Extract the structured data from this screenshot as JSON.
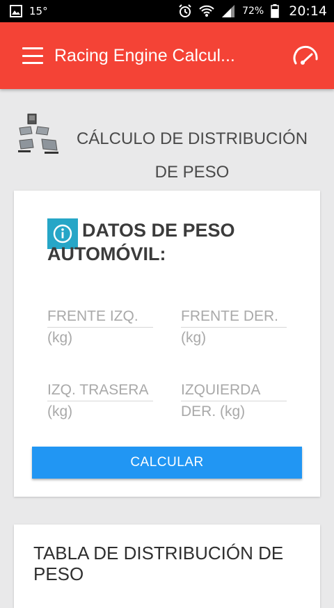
{
  "status_bar": {
    "temperature": "15°",
    "battery": "72%",
    "time": "20:14"
  },
  "app_bar": {
    "title": "Racing Engine Calcul..."
  },
  "section": {
    "title": "CÁLCULO DE DISTRIBUCIÓN DE PESO"
  },
  "input_card": {
    "heading": "DATOS DE PESO AUTOMÓVIL:",
    "fields": [
      {
        "label": "FRENTE IZQ.",
        "unit": "(kg)"
      },
      {
        "label": "FRENTE DER.",
        "unit": "(kg)"
      },
      {
        "label": "IZQ. TRASERA",
        "unit": "(kg)"
      },
      {
        "label": "IZQUIERDA",
        "unit": "DER. (kg)"
      }
    ],
    "button_label": "CALCULAR"
  },
  "table_card": {
    "title": "TABLA DE DISTRIBUCIÓN DE PESO"
  },
  "colors": {
    "app_bar": "#f44336",
    "button": "#2196f3",
    "info_badge": "#26a6c7"
  }
}
